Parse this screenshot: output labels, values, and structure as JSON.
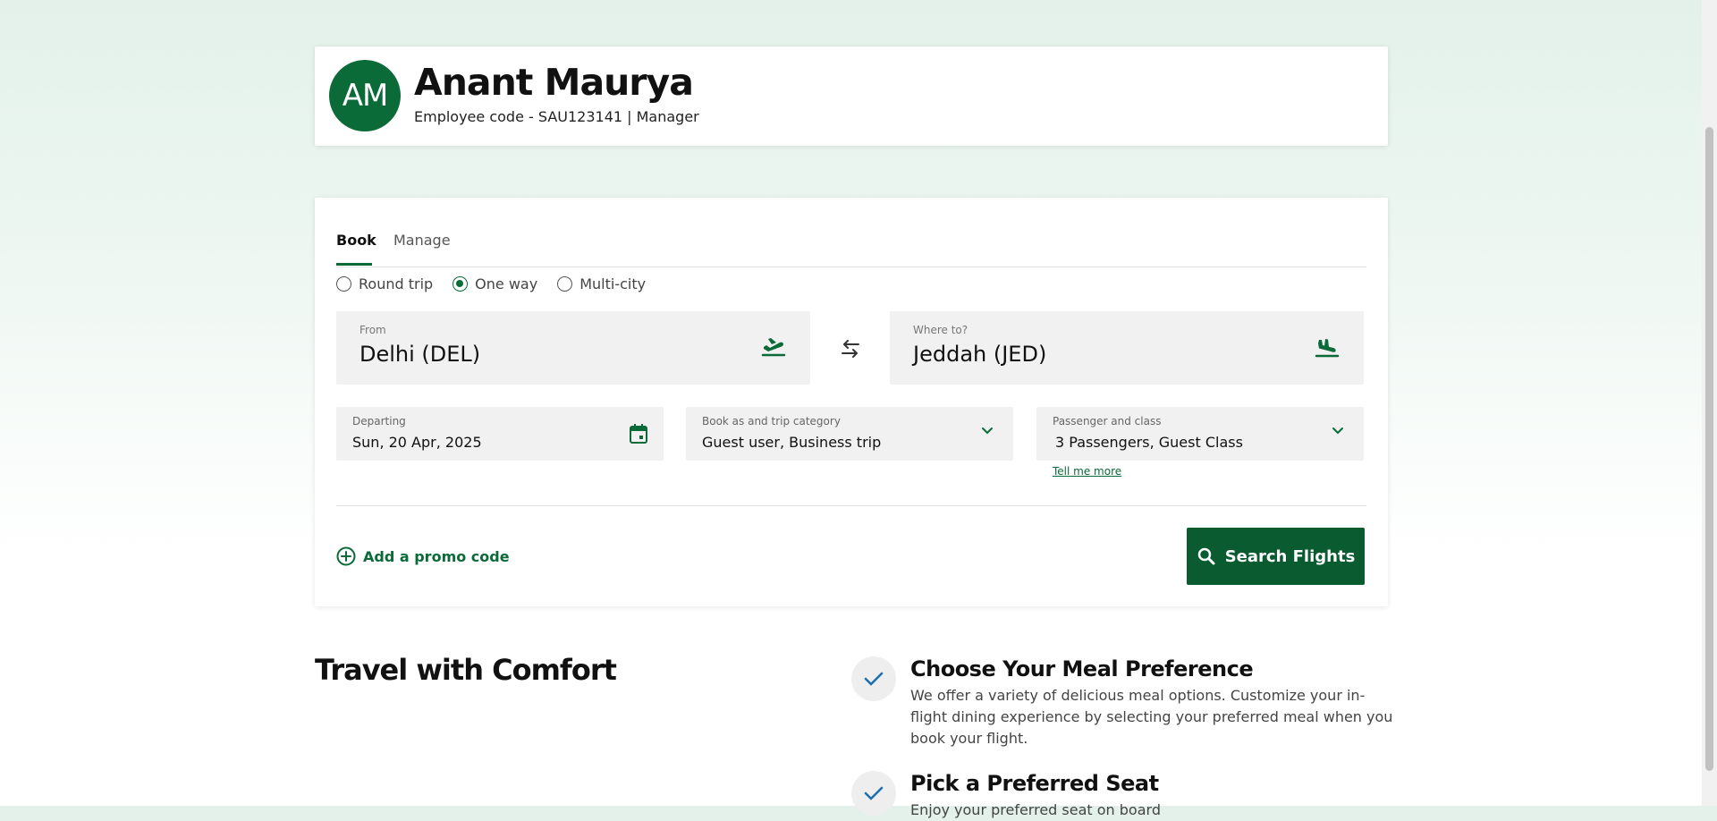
{
  "profile": {
    "initials": "AM",
    "name": "Anant Maurya",
    "meta": "Employee code - SAU123141 | Manager"
  },
  "tabs": [
    {
      "label": "Book",
      "active": true
    },
    {
      "label": "Manage",
      "active": false
    }
  ],
  "trip_types": [
    {
      "label": "Round trip",
      "selected": false
    },
    {
      "label": "One way",
      "selected": true
    },
    {
      "label": "Multi-city",
      "selected": false
    }
  ],
  "from": {
    "label": "From",
    "value": "Delhi (DEL)",
    "icon": "plane-takeoff-icon"
  },
  "to": {
    "label": "Where to?",
    "value": "Jeddah (JED)",
    "icon": "plane-landing-icon"
  },
  "departing": {
    "label": "Departing",
    "value": "Sun, 20 Apr, 2025",
    "icon": "calendar-icon"
  },
  "category": {
    "label": "Book as and trip category",
    "value": "Guest user, Business trip"
  },
  "passengers": {
    "label": "Passenger and class",
    "value": "3 Passengers, Guest Class",
    "tell_more": "Tell me more"
  },
  "promo": {
    "label": "Add a promo code"
  },
  "search": {
    "label": "Search Flights"
  },
  "comfort": {
    "title": "Travel with Comfort",
    "features": [
      {
        "title": "Choose Your Meal Preference",
        "desc": "We offer a variety of delicious meal options. Customize your in-flight dining experience by selecting your preferred meal when you book your flight."
      },
      {
        "title": "Pick a Preferred Seat",
        "desc": "Enjoy your preferred seat on board"
      }
    ]
  },
  "colors": {
    "brand": "#0a6a38",
    "button": "#0a5b30",
    "check": "#1a6fb0"
  }
}
